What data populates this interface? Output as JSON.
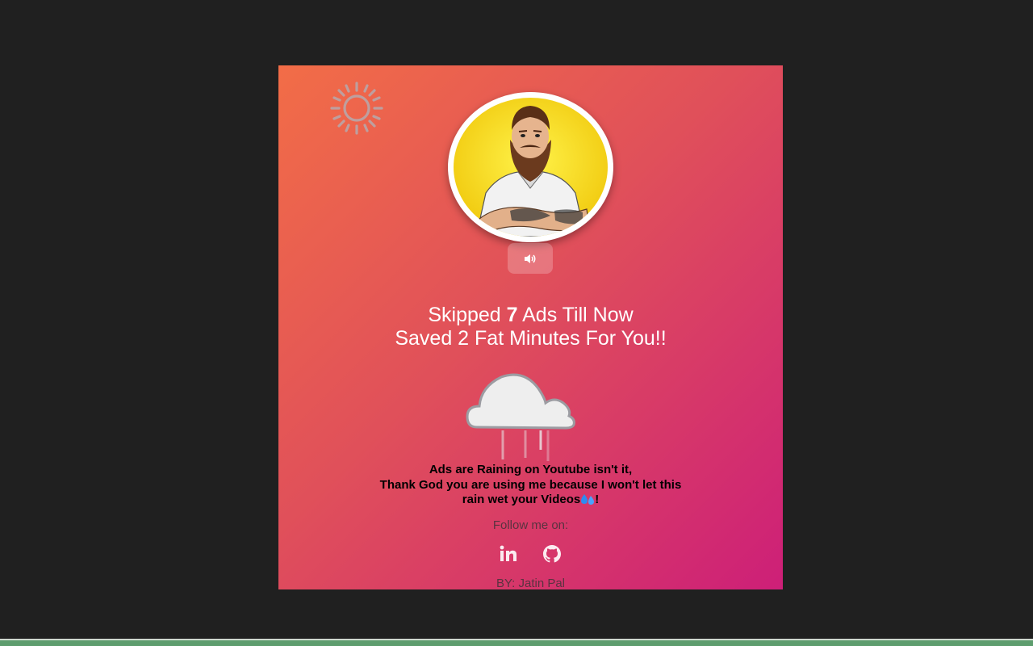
{
  "headline": {
    "line1_prefix": "Skipped ",
    "ads_count": "7",
    "line1_suffix": " Ads Till Now",
    "line2": "Saved 2 Fat Minutes For You!!"
  },
  "message": {
    "line1": "Ads are Raining on Youtube isn't it,",
    "line2": "Thank God you are using me because I won't let this",
    "line3": "rain wet your Videos",
    "line3_end": "!"
  },
  "follow_label": "Follow me on:",
  "socials": [
    {
      "name": "linkedin-icon"
    },
    {
      "name": "github-icon"
    }
  ],
  "author": "BY: Jatin Pal",
  "icons": {
    "sun": "sun-icon",
    "cloud": "rain-cloud-icon",
    "sound": "speaker-icon",
    "avatar": "bearded-man-avatar"
  },
  "colors": {
    "page_bg": "#202020",
    "gradient_start": "#f26d47",
    "gradient_end": "#cd1f78",
    "headline_text": "#ffffff",
    "message_text": "#000000",
    "muted_text": "#5a3340",
    "avatar_bg": "#f5de1a"
  }
}
